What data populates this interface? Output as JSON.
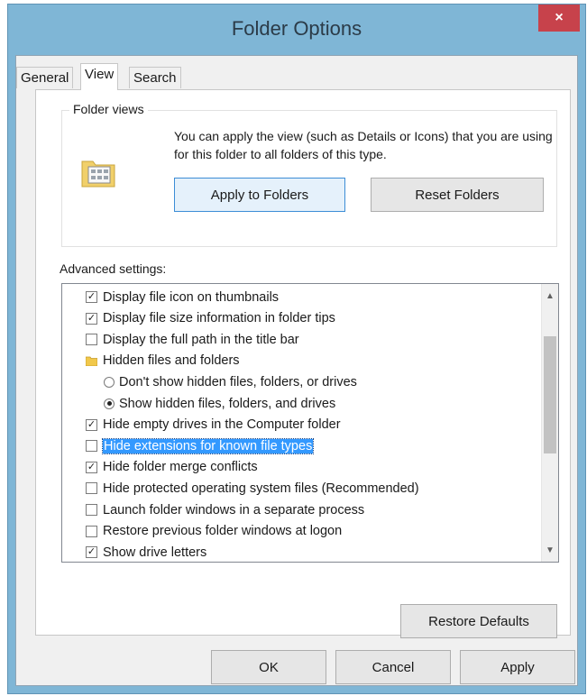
{
  "window": {
    "title": "Folder Options",
    "close_glyph": "×"
  },
  "tabs": [
    {
      "label": "General",
      "active": false
    },
    {
      "label": "View",
      "active": true
    },
    {
      "label": "Search",
      "active": false
    }
  ],
  "folder_views": {
    "label": "Folder views",
    "description": "You can apply the view (such as Details or Icons) that you are using for this folder to all folders of this type.",
    "apply_label": "Apply to Folders",
    "reset_label": "Reset Folders",
    "icon": "folder-view-icon"
  },
  "advanced": {
    "label": "Advanced settings:",
    "items": [
      {
        "kind": "checkbox",
        "checked": true,
        "indent": 0,
        "label": "Display file icon on thumbnails"
      },
      {
        "kind": "checkbox",
        "checked": true,
        "indent": 0,
        "label": "Display file size information in folder tips"
      },
      {
        "kind": "checkbox",
        "checked": false,
        "indent": 0,
        "label": "Display the full path in the title bar"
      },
      {
        "kind": "folder",
        "indent": 0,
        "label": "Hidden files and folders"
      },
      {
        "kind": "radio",
        "checked": false,
        "indent": 1,
        "label": "Don't show hidden files, folders, or drives"
      },
      {
        "kind": "radio",
        "checked": true,
        "indent": 1,
        "label": "Show hidden files, folders, and drives"
      },
      {
        "kind": "checkbox",
        "checked": true,
        "indent": 0,
        "label": "Hide empty drives in the Computer folder"
      },
      {
        "kind": "checkbox",
        "checked": false,
        "indent": 0,
        "selected": true,
        "label": "Hide extensions for known file types"
      },
      {
        "kind": "checkbox",
        "checked": true,
        "indent": 0,
        "label": "Hide folder merge conflicts"
      },
      {
        "kind": "checkbox",
        "checked": false,
        "indent": 0,
        "label": "Hide protected operating system files (Recommended)"
      },
      {
        "kind": "checkbox",
        "checked": false,
        "indent": 0,
        "label": "Launch folder windows in a separate process"
      },
      {
        "kind": "checkbox",
        "checked": false,
        "indent": 0,
        "label": "Restore previous folder windows at logon"
      },
      {
        "kind": "checkbox",
        "checked": true,
        "indent": 0,
        "label": "Show drive letters"
      }
    ]
  },
  "restore_defaults_label": "Restore Defaults",
  "footer": {
    "ok_label": "OK",
    "cancel_label": "Cancel",
    "apply_label": "Apply"
  },
  "colors": {
    "selection": "#3399ff",
    "close": "#c7424b",
    "frame": "#7fb6d6"
  }
}
